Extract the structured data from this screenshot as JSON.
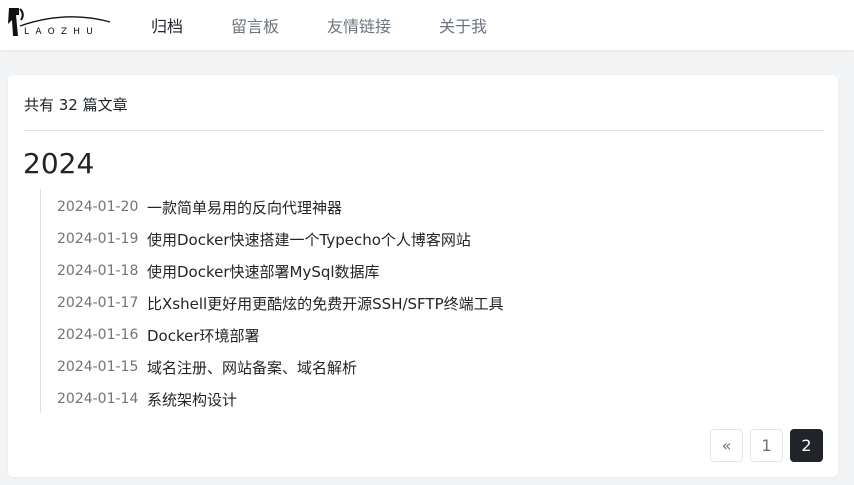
{
  "site": {
    "logo_text": "LAOZHU"
  },
  "nav": {
    "items": [
      {
        "label": "归档",
        "active": true
      },
      {
        "label": "留言板",
        "active": false
      },
      {
        "label": "友情链接",
        "active": false
      },
      {
        "label": "关于我",
        "active": false
      }
    ]
  },
  "archive": {
    "count_text": "共有 32 篇文章",
    "year": "2024",
    "posts": [
      {
        "date": "2024-01-20",
        "title": "一款简单易用的反向代理神器"
      },
      {
        "date": "2024-01-19",
        "title": "使用Docker快速搭建一个Typecho个人博客网站"
      },
      {
        "date": "2024-01-18",
        "title": "使用Docker快速部署MySql数据库"
      },
      {
        "date": "2024-01-17",
        "title": "比Xshell更好用更酷炫的免费开源SSH/SFTP终端工具"
      },
      {
        "date": "2024-01-16",
        "title": "Docker环境部署"
      },
      {
        "date": "2024-01-15",
        "title": "域名注册、网站备案、域名解析"
      },
      {
        "date": "2024-01-14",
        "title": "系统架构设计"
      }
    ]
  },
  "pagination": {
    "prev_label": "«",
    "pages": [
      "1",
      "2"
    ],
    "current": "2"
  },
  "colors": {
    "accent_dark": "#212529",
    "muted": "#6c757d",
    "background": "#f3f4f5"
  }
}
